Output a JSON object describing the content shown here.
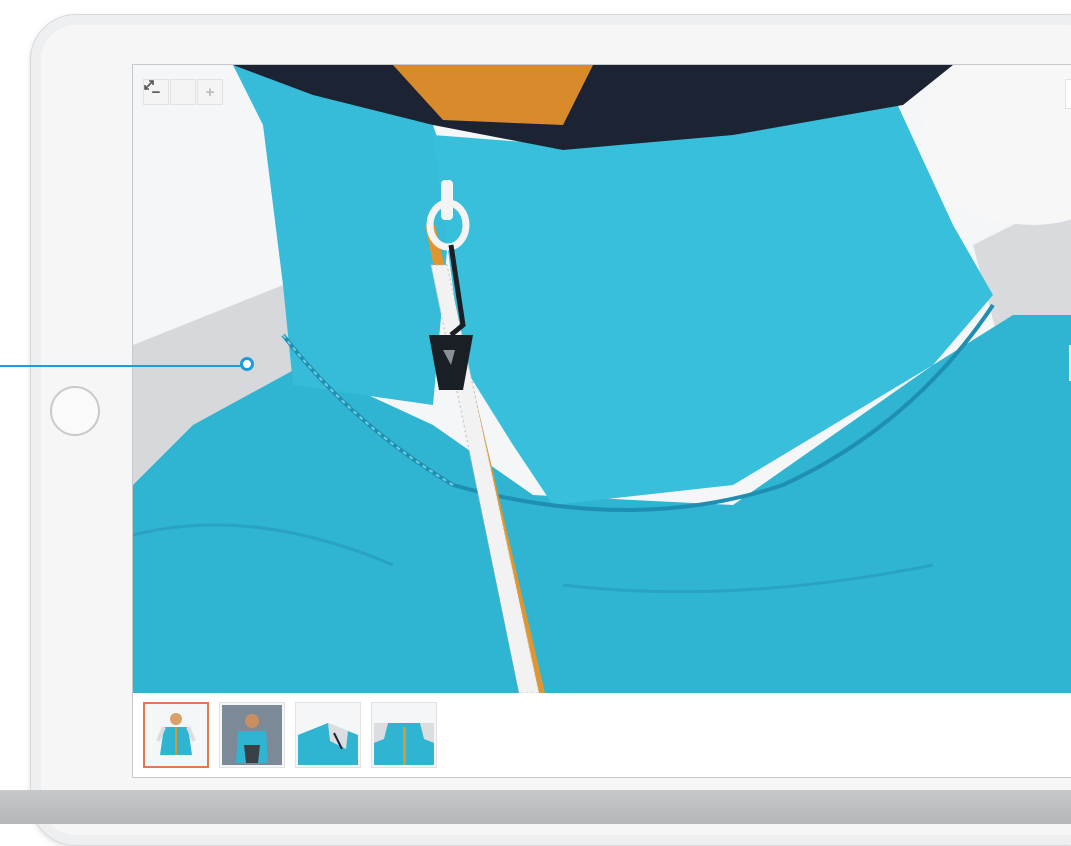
{
  "viewer": {
    "zoom_out_label": "−",
    "fit_icon": "expand-diagonal-icon",
    "zoom_in_label": "+",
    "close_label": "×",
    "next_label": "›"
  },
  "thumbnails": [
    {
      "name": "thumbnail-front-view",
      "selected": true
    },
    {
      "name": "thumbnail-back-view",
      "selected": false
    },
    {
      "name": "thumbnail-shoulder-detail",
      "selected": false
    },
    {
      "name": "thumbnail-collar-detail",
      "selected": false
    }
  ],
  "colors": {
    "jacket": "#2fb4d2",
    "jacket_shadow": "#1e8fb0",
    "collar_trim": "#1c2433",
    "zipper_tape": "#e0962e",
    "panel": "#dcdde0",
    "selected_thumb": "#e07a4f",
    "pointer": "#1a9fd6"
  }
}
